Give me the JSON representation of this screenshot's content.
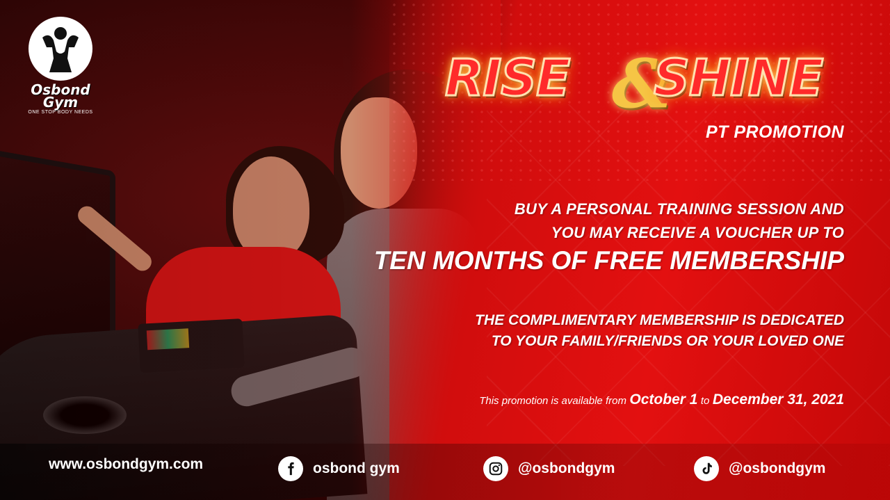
{
  "brand": {
    "name": "Osbond Gym",
    "tagline": "ONE STOP BODY NEEDS"
  },
  "headline": {
    "title_left": "RISE",
    "title_amp": "&",
    "title_right": "SHINE",
    "subtitle": "PT PROMOTION"
  },
  "offer": {
    "line1": "BUY A PERSONAL TRAINING SESSION AND",
    "line2": "YOU MAY RECEIVE A VOUCHER UP TO",
    "highlight": "TEN MONTHS OF FREE MEMBERSHIP",
    "line4": "THE COMPLIMENTARY MEMBERSHIP IS DEDICATED",
    "line5": "TO YOUR FAMILY/FRIENDS OR YOUR LOVED ONE"
  },
  "promo_period": {
    "prefix": "This promotion is available from",
    "start": "October 1",
    "connector": "to",
    "end": "December 31, 2021"
  },
  "footer": {
    "website": "www.osbondgym.com",
    "facebook": "osbond gym",
    "instagram": "@osbondgym",
    "tiktok": "@osbondgym"
  },
  "colors": {
    "accent_red": "#e31010",
    "gold": "#f6c545",
    "white": "#ffffff"
  },
  "icons": [
    "facebook-icon",
    "instagram-icon",
    "tiktok-icon",
    "gym-logo-emblem"
  ]
}
